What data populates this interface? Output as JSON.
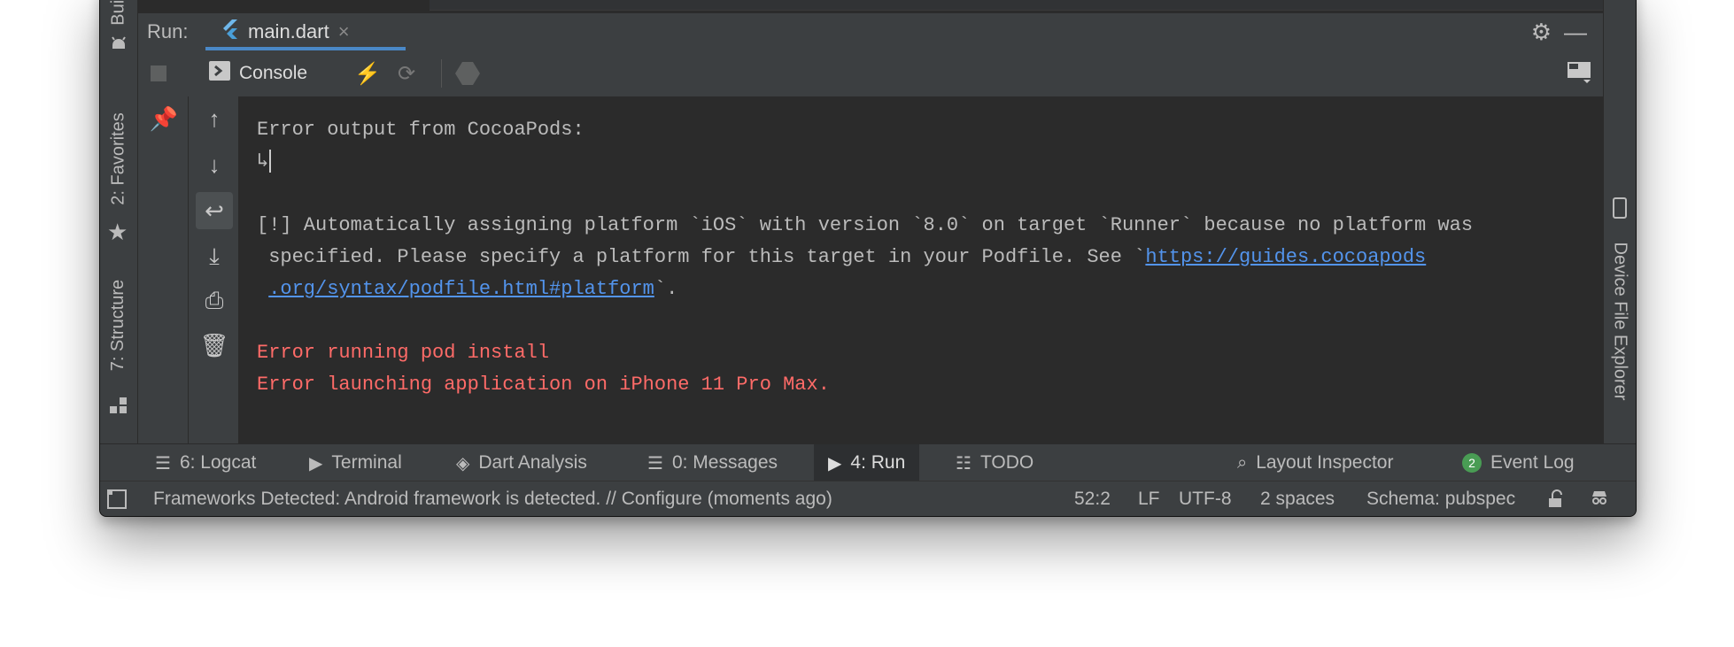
{
  "left_strip": {
    "build_label": "Build",
    "favorites_label": "2: Favorites",
    "structure_label": "7: Structure"
  },
  "right_strip": {
    "device_explorer_label": "Device File Explorer"
  },
  "run_header": {
    "run_label": "Run:",
    "tab_label": "main.dart",
    "tab_close": "×"
  },
  "console_toolbar": {
    "console_label": "Console"
  },
  "console": {
    "line1": "Error output from CocoaPods:",
    "line2": "↳",
    "warn_line1": "[!] Automatically assigning platform `iOS` with version `8.0` on target `Runner` because no platform was",
    "warn_line2_pre": " specified. Please specify a platform for this target in your Podfile. See `",
    "warn_link_part1": "https://guides.cocoapods",
    "warn_link_part2": ".org/syntax/podfile.html#platform",
    "warn_line3_post": "`.",
    "error1": "Error running pod install",
    "error2": "Error launching application on iPhone 11 Pro Max."
  },
  "bottom_tabs": {
    "logcat": "6: Logcat",
    "terminal": "Terminal",
    "dart_analysis": "Dart Analysis",
    "messages": "0: Messages",
    "run": "4: Run",
    "todo": "TODO",
    "layout_inspector": "Layout Inspector",
    "event_log": "Event Log",
    "event_log_count": "2"
  },
  "status_bar": {
    "message": "Frameworks Detected: Android framework is detected. // Configure (moments ago)",
    "position": "52:2",
    "line_sep": "LF",
    "encoding": "UTF-8",
    "indent": "2 spaces",
    "schema": "Schema: pubspec"
  },
  "colors": {
    "accent": "#4a88c7",
    "error": "#ff6b68",
    "link": "#5394ec",
    "badge": "#499c54"
  }
}
